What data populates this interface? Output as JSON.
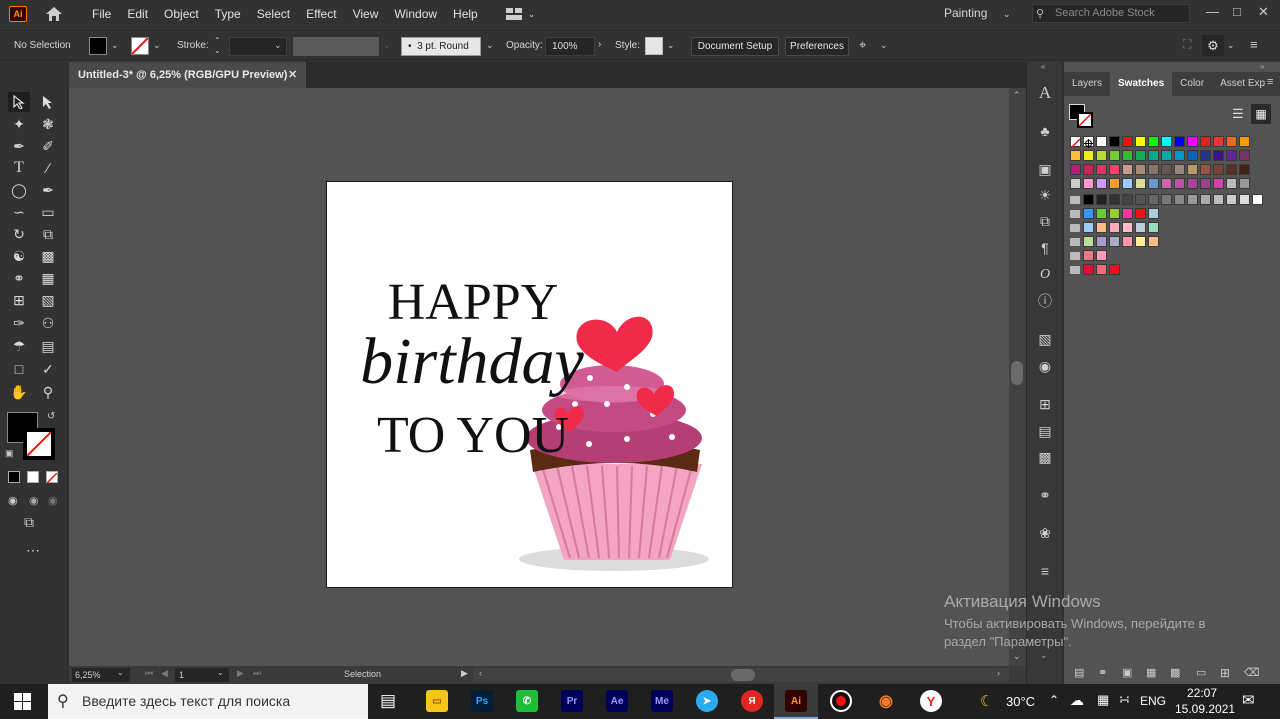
{
  "app": {
    "logo": "Ai",
    "accent": "#ff9a00"
  },
  "menu": [
    "File",
    "Edit",
    "Object",
    "Type",
    "Select",
    "Effect",
    "View",
    "Window",
    "Help"
  ],
  "workspace": "Painting",
  "search_stock_placeholder": "Search Adobe Stock",
  "control": {
    "selection": "No Selection",
    "stroke_label": "Stroke:",
    "brush": "3 pt. Round",
    "opacity_label": "Opacity:",
    "opacity_value": "100%",
    "style_label": "Style:",
    "document_setup": "Document Setup",
    "preferences": "Preferences"
  },
  "document": {
    "tab_title": "Untitled-3* @ 6,25% (RGB/GPU Preview)"
  },
  "artwork": {
    "line1": "HAPPY",
    "line2": "birthday",
    "line3": "TO YOU"
  },
  "status": {
    "zoom": "6,25%",
    "artboard": "1",
    "tool": "Selection"
  },
  "panel": {
    "tabs": [
      "Layers",
      "Swatches",
      "Color",
      "Asset Exp"
    ],
    "active_tab": "Swatches"
  },
  "activation": {
    "title": "Активация Windows",
    "line1": "Чтобы активировать Windows, перейдите в",
    "line2": "раздел \"Параметры\"."
  },
  "taskbar": {
    "search_placeholder": "Введите здесь текст для поиска",
    "weather": "30°C",
    "language": "ENG",
    "time": "22:07",
    "date": "15.09.2021",
    "apps": [
      "Ps",
      "Pr",
      "Ae",
      "Me",
      "Я",
      "Ai"
    ]
  }
}
